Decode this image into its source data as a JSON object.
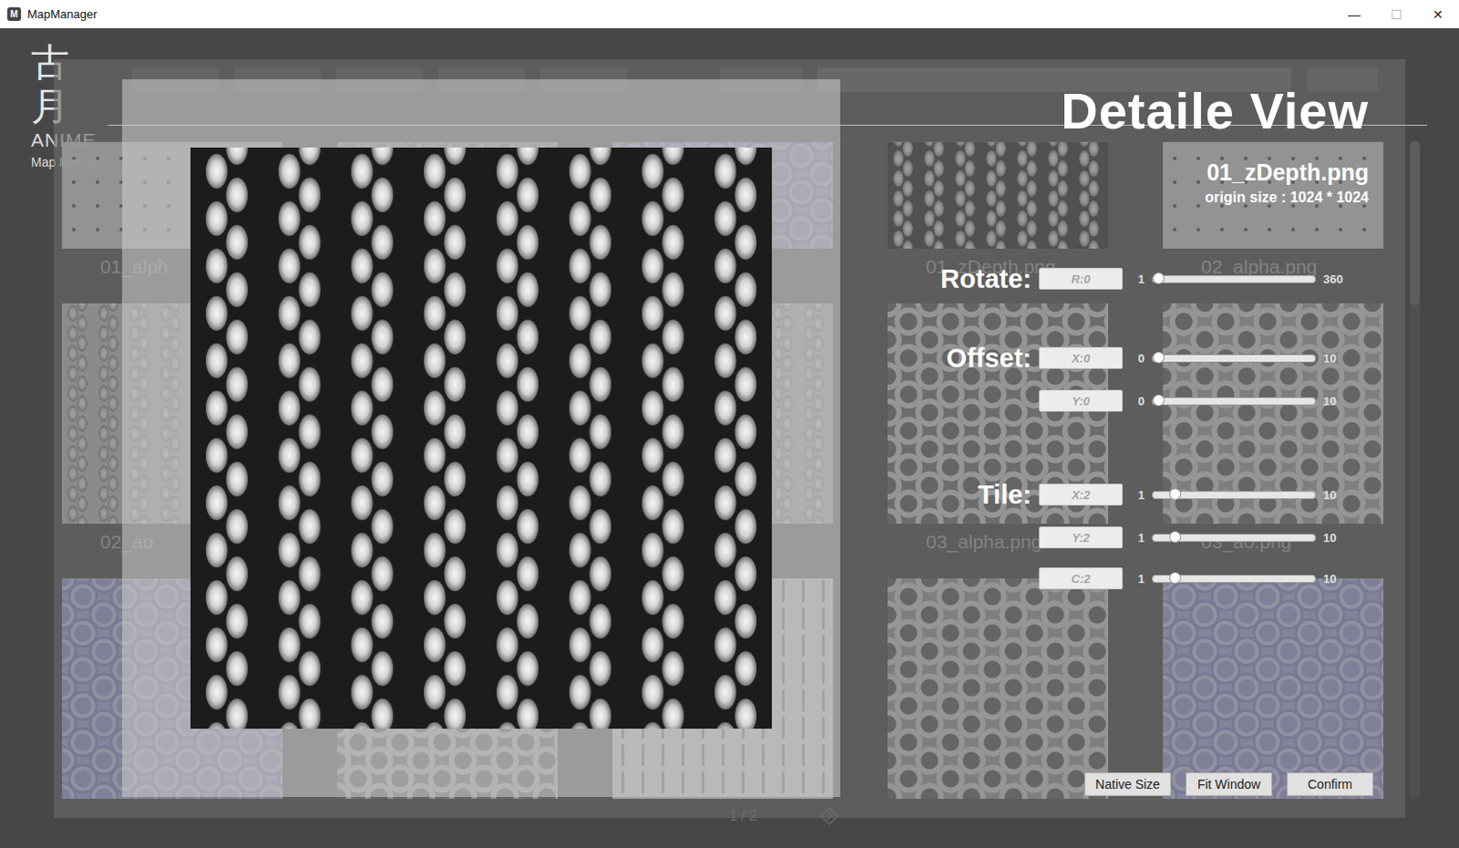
{
  "window": {
    "title": "MapManager",
    "icon": "M",
    "controls": [
      "—",
      "☐",
      "✕"
    ]
  },
  "logo": {
    "mark": "古月",
    "brand": "ANIME",
    "subtitle": "Map Manager"
  },
  "gallery": {
    "items": [
      {
        "kind": "alpha-dots",
        "label": "01_alph"
      },
      {
        "kind": "ao-braid",
        "label": null
      },
      {
        "kind": "normal-hex",
        "label": null
      },
      {
        "kind": "zdepth-braid",
        "label": "01_zDepth.png"
      },
      {
        "kind": "alpha-dots",
        "label": "02_alpha.png"
      },
      {
        "kind": "ao-braid",
        "label": "02_ao"
      },
      {
        "kind": "zdepth-braid",
        "label": null
      },
      {
        "kind": "ao-braid",
        "label": null
      },
      {
        "kind": "alpha-hex",
        "label": "03_alpha.png"
      },
      {
        "kind": "ao-hex",
        "label": "03_ao.png"
      },
      {
        "kind": "normal-hex",
        "label": null
      },
      {
        "kind": "alpha-hex",
        "label": null
      },
      {
        "kind": "height-grid",
        "label": null
      },
      {
        "kind": "ao-hex",
        "label": null
      },
      {
        "kind": "normal-hex",
        "label": null
      }
    ]
  },
  "pager": {
    "text": "1 / 2"
  },
  "detail": {
    "title": "Detaile View",
    "file": "01_zDepth.png",
    "size": "origin size : 1024 * 1024",
    "controls": [
      {
        "label": "Rotate:",
        "fields": [
          {
            "text": "R:0",
            "min": "1",
            "max": "360",
            "level": 0
          }
        ]
      },
      {
        "label": "Offset:",
        "fields": [
          {
            "text": "X:0",
            "min": "0",
            "max": "10",
            "level": 0
          },
          {
            "text": "Y:0",
            "min": "0",
            "max": "10",
            "level": 0
          }
        ]
      },
      {
        "label": "Tile:",
        "fields": [
          {
            "text": "X:2",
            "min": "1",
            "max": "10",
            "level": 0.11
          },
          {
            "text": "Y:2",
            "min": "1",
            "max": "10",
            "level": 0.11
          },
          {
            "text": "C:2",
            "min": "1",
            "max": "10",
            "level": 0.11
          }
        ]
      }
    ],
    "buttons": [
      "Native Size",
      "Fit Window",
      "Confirm"
    ]
  }
}
